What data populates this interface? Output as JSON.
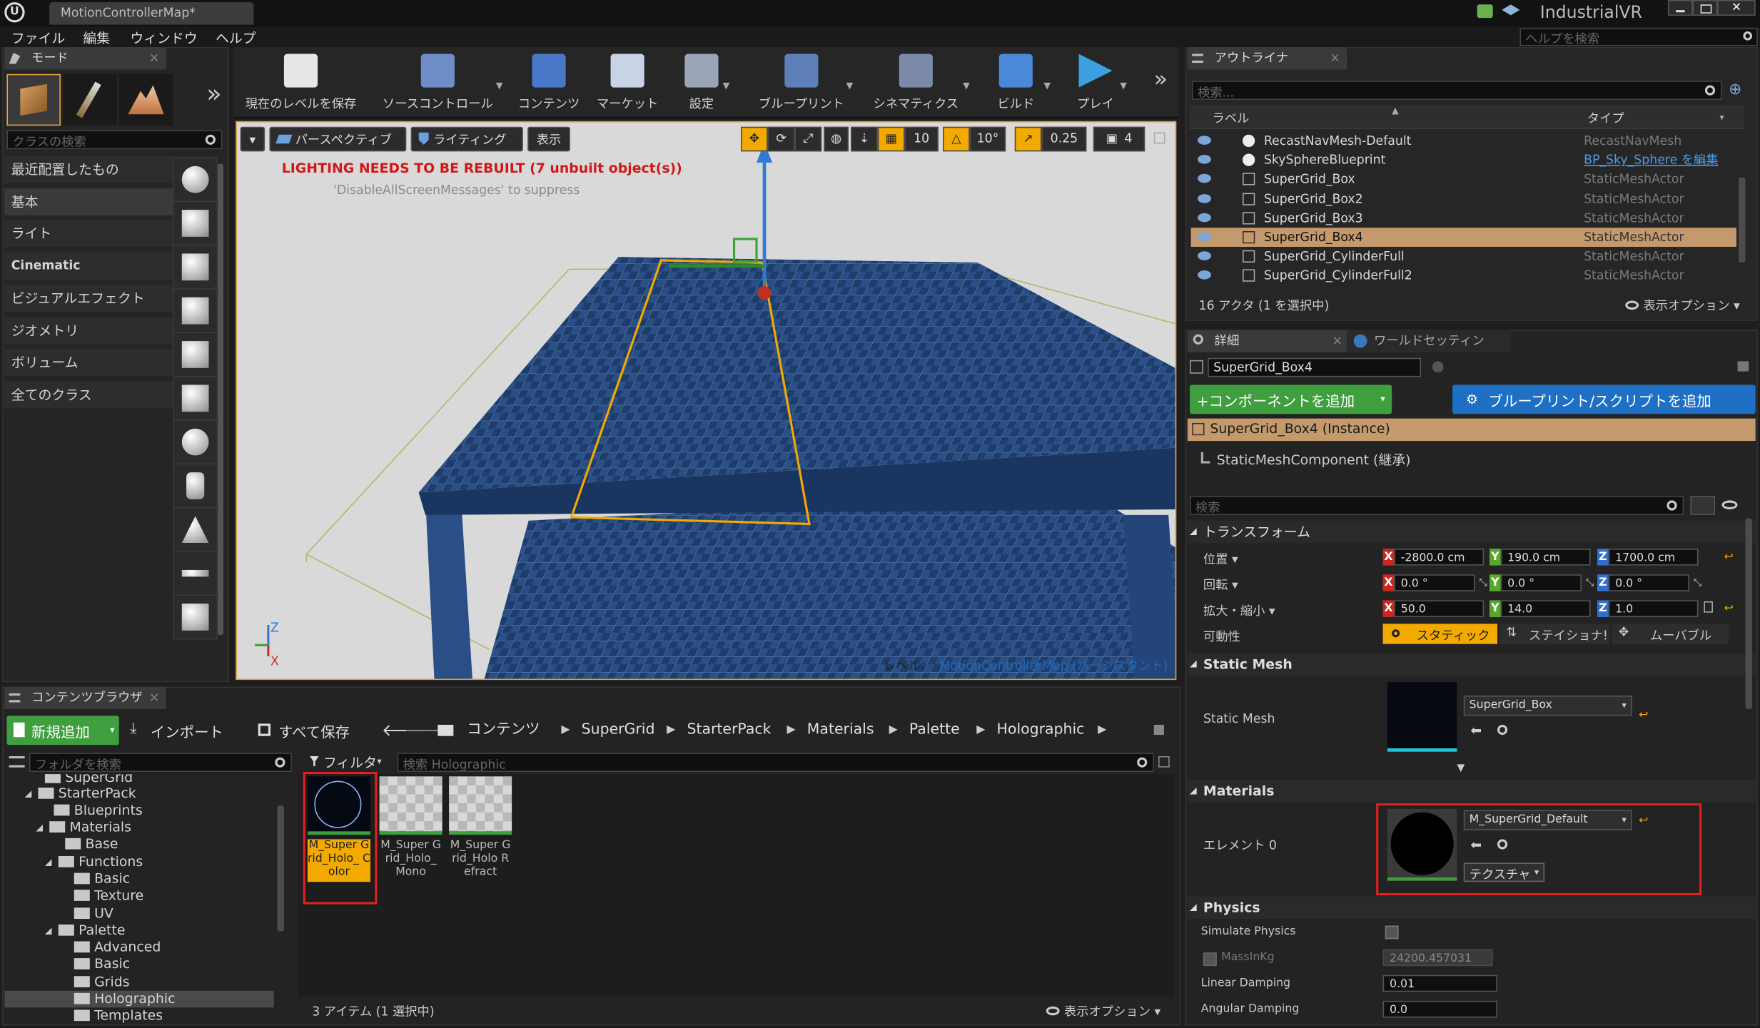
{
  "window": {
    "tab_title": "MotionControllerMap*",
    "project": "IndustrialVR",
    "help_search_placeholder": "ヘルプを検索"
  },
  "menu": [
    "ファイル",
    "編集",
    "ウィンドウ",
    "ヘルプ"
  ],
  "modes": {
    "tab": "モード",
    "search_placeholder": "クラスの検索",
    "categories": [
      "最近配置したもの",
      "基本",
      "ライト",
      "Cinematic",
      "ビジュアルエフェクト",
      "ジオメトリ",
      "ボリューム",
      "全てのクラス"
    ],
    "selected_category": "基本",
    "more": "»"
  },
  "toolbar": {
    "buttons": [
      {
        "label": "現在のレベルを保存",
        "icon": "save-icon"
      },
      {
        "label": "ソースコントロール",
        "icon": "source-control-icon"
      },
      {
        "label": "コンテンツ",
        "icon": "content-icon"
      },
      {
        "label": "マーケット",
        "icon": "marketplace-icon"
      },
      {
        "label": "設定",
        "icon": "settings-icon"
      },
      {
        "label": "ブループリント",
        "icon": "blueprint-icon"
      },
      {
        "label": "シネマティクス",
        "icon": "cinematics-icon"
      },
      {
        "label": "ビルド",
        "icon": "build-icon"
      },
      {
        "label": "プレイ",
        "icon": "play-icon"
      }
    ],
    "more": "»"
  },
  "viewport": {
    "perspective": "パースペクティブ",
    "lighting": "ライティング",
    "show": "表示",
    "grid_snap": "10",
    "rot_snap": "10°",
    "scale_snap": "0.25",
    "cam_speed": "4",
    "warning": "LIGHTING NEEDS TO BE REBUILT (7 unbuilt object(s))",
    "suppress": "'DisableAllScreenMessages' to suppress",
    "level_label": "レベル：",
    "level_name": "MotionControllerMap (パーシスタント)",
    "axis_z": "Z",
    "axis_x": "X"
  },
  "outliner": {
    "tab": "アウトライナ",
    "search_placeholder": "検索...",
    "col_label": "ラベル",
    "col_type": "タイプ",
    "rows": [
      {
        "name": "RecastNavMesh-Default",
        "type": "RecastNavMesh",
        "selected": false,
        "link": false
      },
      {
        "name": "SkySphereBlueprint",
        "type": "BP_Sky_Sphere を編集",
        "selected": false,
        "link": true
      },
      {
        "name": "SuperGrid_Box",
        "type": "StaticMeshActor",
        "selected": false,
        "link": false
      },
      {
        "name": "SuperGrid_Box2",
        "type": "StaticMeshActor",
        "selected": false,
        "link": false
      },
      {
        "name": "SuperGrid_Box3",
        "type": "StaticMeshActor",
        "selected": false,
        "link": false
      },
      {
        "name": "SuperGrid_Box4",
        "type": "StaticMeshActor",
        "selected": true,
        "link": false
      },
      {
        "name": "SuperGrid_CylinderFull",
        "type": "StaticMeshActor",
        "selected": false,
        "link": false
      },
      {
        "name": "SuperGrid_CylinderFull2",
        "type": "StaticMeshActor",
        "selected": false,
        "link": false
      }
    ],
    "footer": "16 アクタ (1 を選択中)",
    "view_options": "表示オプション"
  },
  "details": {
    "tab": "詳細",
    "world_tab": "ワールドセッティン",
    "name": "SuperGrid_Box4",
    "add_component": "+コンポーネントを追加",
    "add_blueprint": "ブループリント/スクリプトを追加",
    "instance": "SuperGrid_Box4 (Instance)",
    "component": "StaticMeshComponent (継承)",
    "search_placeholder": "検索",
    "transform": {
      "header": "トランスフォーム",
      "location_label": "位置",
      "rotation_label": "回転",
      "scale_label": "拡大・縮小",
      "mobility_label": "可動性",
      "location": {
        "x": "-2800.0 cm",
        "y": "190.0 cm",
        "z": "1700.0 cm"
      },
      "rotation": {
        "x": "0.0 °",
        "y": "0.0 °",
        "z": "0.0 °"
      },
      "scale": {
        "x": "50.0",
        "y": "14.0",
        "z": "1.0"
      },
      "mobility": {
        "static": "スタティック",
        "stationary": "ステイショナ!",
        "movable": "ムーバブル"
      }
    },
    "static_mesh": {
      "header": "Static Mesh",
      "label": "Static Mesh",
      "value": "SuperGrid_Box"
    },
    "materials": {
      "header": "Materials",
      "element_label": "エレメント 0",
      "value": "M_SuperGrid_Default",
      "texture": "テクスチャ"
    },
    "physics": {
      "header": "Physics",
      "simulate": "Simulate Physics",
      "mass_label": "MassInKg",
      "mass_value": "24200.457031",
      "linear_label": "Linear Damping",
      "linear_value": "0.01",
      "angular_label": "Angular Damping",
      "angular_value": "0.0"
    }
  },
  "content_browser": {
    "tab": "コンテンツブラウザ",
    "add_new": "新規追加",
    "import": "インポート",
    "save_all": "すべて保存",
    "breadcrumb": [
      "コンテンツ",
      "SuperGrid",
      "StarterPack",
      "Materials",
      "Palette",
      "Holographic"
    ],
    "folder_search_placeholder": "フォルダを検索",
    "filter": "フィルタ",
    "asset_search_placeholder": "検索 Holographic",
    "tree": [
      "SuperGrid",
      "StarterPack",
      "Blueprints",
      "Materials",
      "Base",
      "Functions",
      "Basic",
      "Texture",
      "UV",
      "Palette",
      "Advanced",
      "Basic",
      "Grids",
      "Holographic",
      "Templates"
    ],
    "tree_selected": "Holographic",
    "assets": [
      {
        "label": "M_Super Grid_Holo_ Color",
        "selected": true
      },
      {
        "label": "M_Super Grid_Holo_ Mono",
        "selected": false
      },
      {
        "label": "M_Super Grid_Holo Refract",
        "selected": false
      }
    ],
    "footer": "3 アイテム (1 選択中)",
    "view_options": "表示オプション"
  },
  "colors": {
    "accent_orange": "#f2a900",
    "selection_tan": "#c49a6c",
    "add_green": "#3f9f3f",
    "blueprint_blue": "#1f6fc4",
    "highlight_red": "#e02020",
    "warning_red": "#d01818"
  }
}
